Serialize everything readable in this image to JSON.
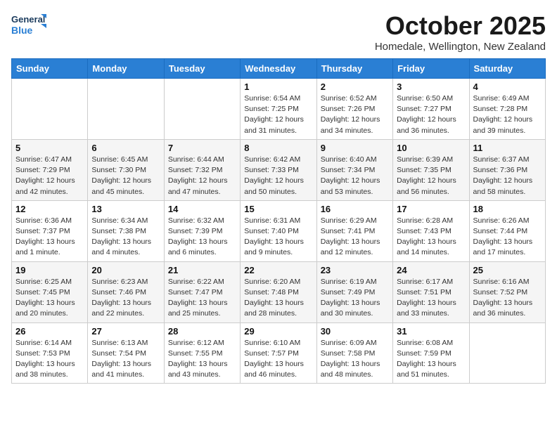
{
  "logo": {
    "line1": "General",
    "line2": "Blue"
  },
  "title": "October 2025",
  "location": "Homedale, Wellington, New Zealand",
  "days_of_week": [
    "Sunday",
    "Monday",
    "Tuesday",
    "Wednesday",
    "Thursday",
    "Friday",
    "Saturday"
  ],
  "weeks": [
    [
      {
        "day": "",
        "info": ""
      },
      {
        "day": "",
        "info": ""
      },
      {
        "day": "",
        "info": ""
      },
      {
        "day": "1",
        "info": "Sunrise: 6:54 AM\nSunset: 7:25 PM\nDaylight: 12 hours\nand 31 minutes."
      },
      {
        "day": "2",
        "info": "Sunrise: 6:52 AM\nSunset: 7:26 PM\nDaylight: 12 hours\nand 34 minutes."
      },
      {
        "day": "3",
        "info": "Sunrise: 6:50 AM\nSunset: 7:27 PM\nDaylight: 12 hours\nand 36 minutes."
      },
      {
        "day": "4",
        "info": "Sunrise: 6:49 AM\nSunset: 7:28 PM\nDaylight: 12 hours\nand 39 minutes."
      }
    ],
    [
      {
        "day": "5",
        "info": "Sunrise: 6:47 AM\nSunset: 7:29 PM\nDaylight: 12 hours\nand 42 minutes."
      },
      {
        "day": "6",
        "info": "Sunrise: 6:45 AM\nSunset: 7:30 PM\nDaylight: 12 hours\nand 45 minutes."
      },
      {
        "day": "7",
        "info": "Sunrise: 6:44 AM\nSunset: 7:32 PM\nDaylight: 12 hours\nand 47 minutes."
      },
      {
        "day": "8",
        "info": "Sunrise: 6:42 AM\nSunset: 7:33 PM\nDaylight: 12 hours\nand 50 minutes."
      },
      {
        "day": "9",
        "info": "Sunrise: 6:40 AM\nSunset: 7:34 PM\nDaylight: 12 hours\nand 53 minutes."
      },
      {
        "day": "10",
        "info": "Sunrise: 6:39 AM\nSunset: 7:35 PM\nDaylight: 12 hours\nand 56 minutes."
      },
      {
        "day": "11",
        "info": "Sunrise: 6:37 AM\nSunset: 7:36 PM\nDaylight: 12 hours\nand 58 minutes."
      }
    ],
    [
      {
        "day": "12",
        "info": "Sunrise: 6:36 AM\nSunset: 7:37 PM\nDaylight: 13 hours\nand 1 minute."
      },
      {
        "day": "13",
        "info": "Sunrise: 6:34 AM\nSunset: 7:38 PM\nDaylight: 13 hours\nand 4 minutes."
      },
      {
        "day": "14",
        "info": "Sunrise: 6:32 AM\nSunset: 7:39 PM\nDaylight: 13 hours\nand 6 minutes."
      },
      {
        "day": "15",
        "info": "Sunrise: 6:31 AM\nSunset: 7:40 PM\nDaylight: 13 hours\nand 9 minutes."
      },
      {
        "day": "16",
        "info": "Sunrise: 6:29 AM\nSunset: 7:41 PM\nDaylight: 13 hours\nand 12 minutes."
      },
      {
        "day": "17",
        "info": "Sunrise: 6:28 AM\nSunset: 7:43 PM\nDaylight: 13 hours\nand 14 minutes."
      },
      {
        "day": "18",
        "info": "Sunrise: 6:26 AM\nSunset: 7:44 PM\nDaylight: 13 hours\nand 17 minutes."
      }
    ],
    [
      {
        "day": "19",
        "info": "Sunrise: 6:25 AM\nSunset: 7:45 PM\nDaylight: 13 hours\nand 20 minutes."
      },
      {
        "day": "20",
        "info": "Sunrise: 6:23 AM\nSunset: 7:46 PM\nDaylight: 13 hours\nand 22 minutes."
      },
      {
        "day": "21",
        "info": "Sunrise: 6:22 AM\nSunset: 7:47 PM\nDaylight: 13 hours\nand 25 minutes."
      },
      {
        "day": "22",
        "info": "Sunrise: 6:20 AM\nSunset: 7:48 PM\nDaylight: 13 hours\nand 28 minutes."
      },
      {
        "day": "23",
        "info": "Sunrise: 6:19 AM\nSunset: 7:49 PM\nDaylight: 13 hours\nand 30 minutes."
      },
      {
        "day": "24",
        "info": "Sunrise: 6:17 AM\nSunset: 7:51 PM\nDaylight: 13 hours\nand 33 minutes."
      },
      {
        "day": "25",
        "info": "Sunrise: 6:16 AM\nSunset: 7:52 PM\nDaylight: 13 hours\nand 36 minutes."
      }
    ],
    [
      {
        "day": "26",
        "info": "Sunrise: 6:14 AM\nSunset: 7:53 PM\nDaylight: 13 hours\nand 38 minutes."
      },
      {
        "day": "27",
        "info": "Sunrise: 6:13 AM\nSunset: 7:54 PM\nDaylight: 13 hours\nand 41 minutes."
      },
      {
        "day": "28",
        "info": "Sunrise: 6:12 AM\nSunset: 7:55 PM\nDaylight: 13 hours\nand 43 minutes."
      },
      {
        "day": "29",
        "info": "Sunrise: 6:10 AM\nSunset: 7:57 PM\nDaylight: 13 hours\nand 46 minutes."
      },
      {
        "day": "30",
        "info": "Sunrise: 6:09 AM\nSunset: 7:58 PM\nDaylight: 13 hours\nand 48 minutes."
      },
      {
        "day": "31",
        "info": "Sunrise: 6:08 AM\nSunset: 7:59 PM\nDaylight: 13 hours\nand 51 minutes."
      },
      {
        "day": "",
        "info": ""
      }
    ]
  ]
}
